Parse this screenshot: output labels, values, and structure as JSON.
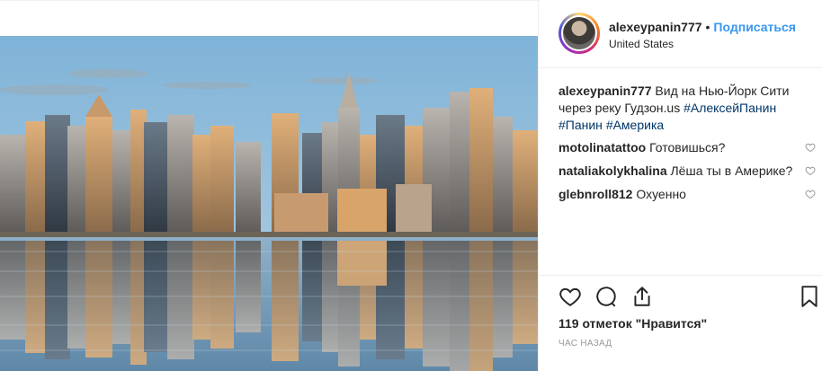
{
  "post": {
    "author": {
      "username": "alexeypanin777",
      "separator": "•",
      "follow_label": "Подписаться",
      "location": "United States"
    },
    "caption": {
      "username": "alexeypanin777",
      "text": " Вид на Нью-Йорк Сити через реку Гудзон.us ",
      "hashtags": [
        "#АлексейПанин",
        "#Панин",
        "#Америка"
      ]
    },
    "comments": [
      {
        "username": "motolinatattoo",
        "text": " Готовишься?"
      },
      {
        "username": "nataliakolykhalina",
        "text": " Лёша ты в Америке?"
      },
      {
        "username": "glebnroll812",
        "text": " Охуенно"
      }
    ],
    "likes_label": "119 отметок \"Нравится\"",
    "timestamp": "ЧАС НАЗАД"
  },
  "icons": {
    "like": "heart-icon",
    "comment": "comment-icon",
    "share": "share-icon",
    "save": "bookmark-icon",
    "comment_like": "heart-icon-small"
  },
  "colors": {
    "link": "#3897f0",
    "hashtag": "#003569",
    "text": "#262626",
    "muted": "#999999",
    "border": "#efefef"
  }
}
